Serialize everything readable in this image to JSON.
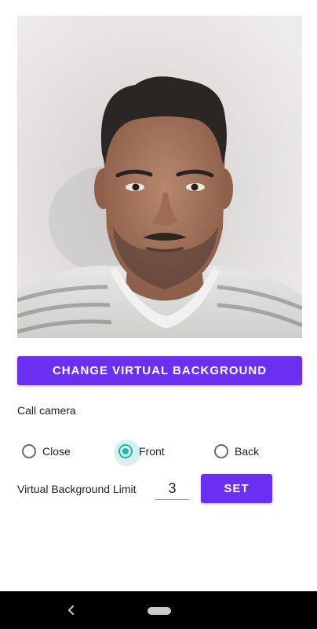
{
  "preview": {
    "icon": "camera-preview-image"
  },
  "actions": {
    "change_background_label": "CHANGE VIRTUAL BACKGROUND"
  },
  "call_camera": {
    "label": "Call camera",
    "selected": "Front",
    "options": [
      {
        "label": "Close",
        "checked": false
      },
      {
        "label": "Front",
        "checked": true
      },
      {
        "label": "Back",
        "checked": false
      }
    ],
    "accent_color": "#21b3a8"
  },
  "limit": {
    "label": "Virtual Background Limit",
    "value": "3",
    "set_label": "SET"
  },
  "theme": {
    "primary": "#6a2ff0"
  },
  "nav": {
    "back_icon": "back-chevron-icon",
    "home_icon": "home-pill-icon"
  }
}
